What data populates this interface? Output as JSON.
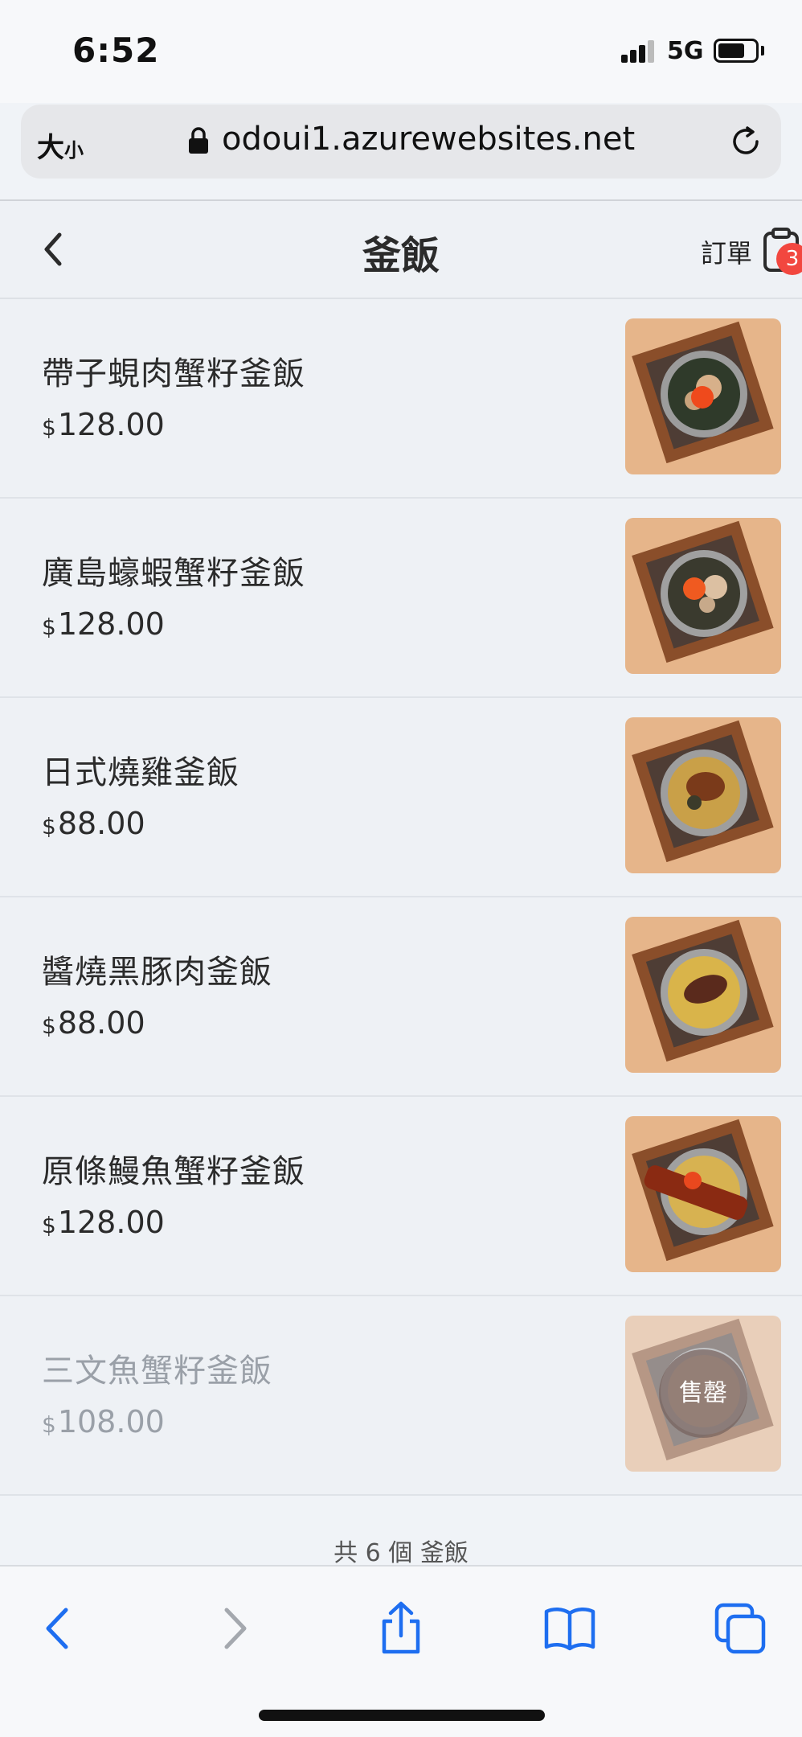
{
  "status_bar": {
    "time": "6:52",
    "network": "5G"
  },
  "browser": {
    "text_size_label": "大",
    "text_size_small": "小",
    "url": "odoui1.azurewebsites.net"
  },
  "header": {
    "title": "釜飯",
    "orders_label": "訂單",
    "orders_count": "3"
  },
  "items": [
    {
      "name": "帶子蜆肉蟹籽釜飯",
      "currency": "$",
      "price": "128.00",
      "sold_out": false
    },
    {
      "name": "廣島蠔蝦蟹籽釜飯",
      "currency": "$",
      "price": "128.00",
      "sold_out": false
    },
    {
      "name": "日式燒雞釜飯",
      "currency": "$",
      "price": "88.00",
      "sold_out": false
    },
    {
      "name": "醬燒黑豚肉釜飯",
      "currency": "$",
      "price": "88.00",
      "sold_out": false
    },
    {
      "name": "原條鰻魚蟹籽釜飯",
      "currency": "$",
      "price": "128.00",
      "sold_out": false
    },
    {
      "name": "三文魚蟹籽釜飯",
      "currency": "$",
      "price": "108.00",
      "sold_out": true,
      "sold_out_label": "售罄"
    }
  ],
  "footer": {
    "count_text": "共 6 個 釜飯"
  },
  "colors": {
    "accent_blue": "#1e6ef0",
    "badge_red": "#f2473f",
    "page_bg": "#eef1f5"
  }
}
